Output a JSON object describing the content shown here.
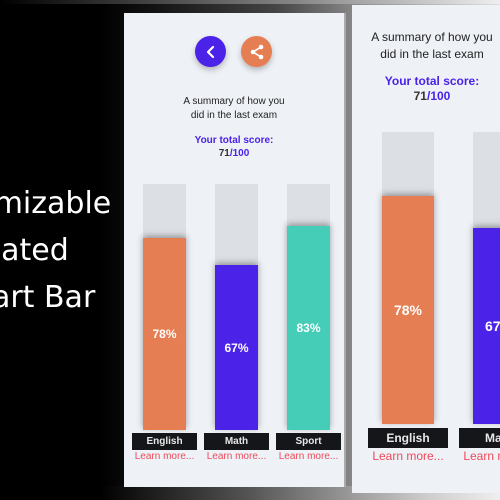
{
  "promo": {
    "lines": [
      "Customizable",
      "Animated",
      "Chart Bar"
    ]
  },
  "screen": {
    "summary_line1": "A summary of how you",
    "summary_line2": "did in the last exam",
    "score_label": "Your total score:",
    "score_value": "71",
    "score_sep": "/",
    "score_max": "100",
    "learn_more": "Learn more...",
    "back_icon": "chevron-left-icon",
    "share_icon": "share-icon"
  },
  "colors": {
    "english": "#e57e52",
    "math": "#4a22e8",
    "sport": "#46cdb7",
    "track": "#dcdfe4",
    "accent": "#4a22e8",
    "link": "#ee4a5a"
  },
  "chart_data": {
    "type": "bar",
    "title": "A summary of how you did in the last exam",
    "categories": [
      "English",
      "Math",
      "Sport"
    ],
    "values": [
      78,
      67,
      83
    ],
    "value_labels": [
      "78%",
      "67%",
      "83%"
    ],
    "ylim": [
      0,
      100
    ],
    "total_score": "71/100"
  }
}
